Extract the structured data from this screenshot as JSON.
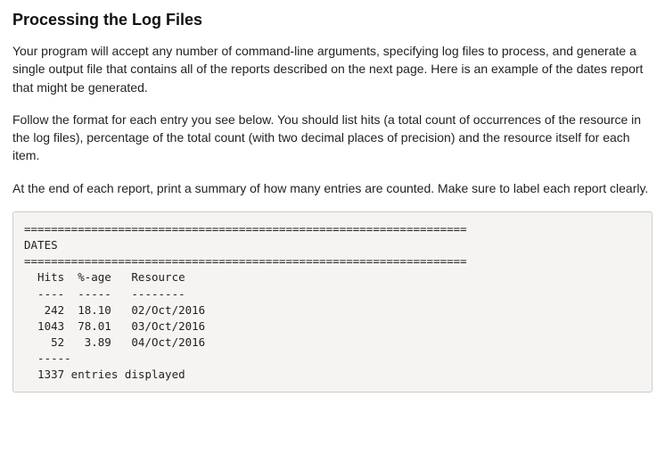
{
  "heading": "Processing the Log Files",
  "paragraphs": [
    "Your program will accept any number of command-line arguments, specifying log files to process, and generate a single output file that contains all of the reports described on the next page. Here is an example of the dates report that might be generated.",
    "Follow the format for each entry you see below. You should list hits (a total count of occurrences of the resource in the log files), percentage of the total count (with two decimal places of precision) and the resource itself for each item.",
    "At the end of each report, print a summary of how many entries are counted. Make sure to label each report clearly."
  ],
  "chart_data": {
    "type": "table",
    "title": "DATES",
    "columns": [
      "Hits",
      "%-age",
      "Resource"
    ],
    "rows": [
      {
        "hits": 242,
        "pct": 18.1,
        "resource": "02/Oct/2016"
      },
      {
        "hits": 1043,
        "pct": 78.01,
        "resource": "03/Oct/2016"
      },
      {
        "hits": 52,
        "pct": 3.89,
        "resource": "04/Oct/2016"
      }
    ],
    "summary_count": 1337,
    "summary_label": "entries displayed"
  },
  "report_formatting": {
    "divider": "==================================================================",
    "col_dividers": "  ----  -----   --------",
    "footer_divider": "  -----"
  }
}
